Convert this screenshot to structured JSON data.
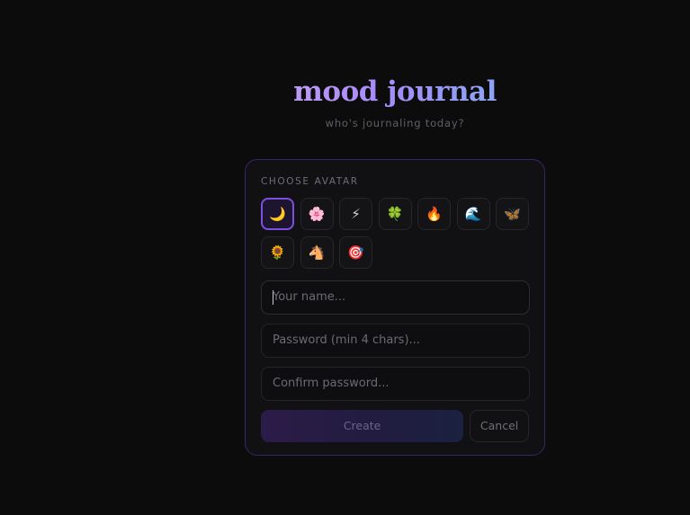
{
  "header": {
    "title": "mood journal",
    "subtitle": "who's journaling today?"
  },
  "form": {
    "avatar_label": "CHOOSE AVATAR",
    "avatars": [
      {
        "glyph": "🌙",
        "icon": "crescent-moon-icon",
        "selected": true
      },
      {
        "glyph": "🌸",
        "icon": "cherry-blossom-icon",
        "selected": false
      },
      {
        "glyph": "⚡",
        "icon": "lightning-icon",
        "selected": false
      },
      {
        "glyph": "🍀",
        "icon": "four-leaf-clover-icon",
        "selected": false
      },
      {
        "glyph": "🔥",
        "icon": "fire-icon",
        "selected": false
      },
      {
        "glyph": "🌊",
        "icon": "wave-icon",
        "selected": false
      },
      {
        "glyph": "🦋",
        "icon": "butterfly-icon",
        "selected": false
      },
      {
        "glyph": "🌻",
        "icon": "sunflower-icon",
        "selected": false
      },
      {
        "glyph": "🐴",
        "icon": "horse-icon",
        "selected": false
      },
      {
        "glyph": "🎯",
        "icon": "target-icon",
        "selected": false
      }
    ],
    "name_placeholder": "Your name...",
    "name_value": "",
    "password_placeholder": "Password (min 4 chars)...",
    "password_value": "",
    "confirm_placeholder": "Confirm password...",
    "confirm_value": "",
    "create_label": "Create",
    "cancel_label": "Cancel"
  },
  "colors": {
    "background": "#0c0c0d",
    "card_border": "#3a2469",
    "accent": "#7c4fe0",
    "title_gradient_start": "#c5a3f0",
    "title_gradient_end": "#7fb0ee"
  }
}
